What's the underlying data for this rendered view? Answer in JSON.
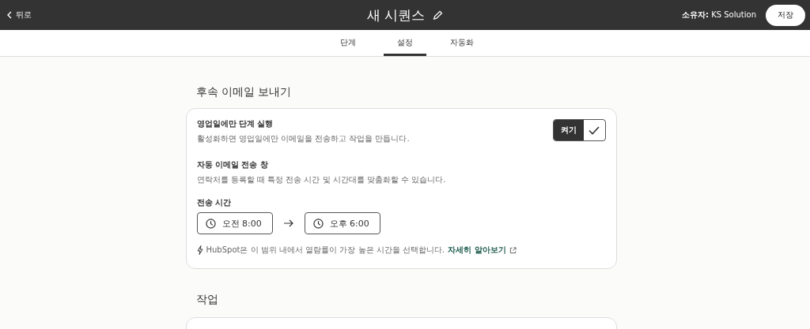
{
  "header": {
    "back": "뒤로",
    "title": "새 시퀀스",
    "owner_label": "소유자:",
    "owner": "KS Solution",
    "save": "저장"
  },
  "tabs": [
    {
      "label": "단계",
      "selected": false
    },
    {
      "label": "설정",
      "selected": true
    },
    {
      "label": "자동화",
      "selected": false
    }
  ],
  "section": {
    "title": "후속 이메일 보내기",
    "business_days": {
      "title": "영업일에만 단계 실행",
      "description": "활성화하면 영업일에만 이메일을 전송하고 작업을 만듭니다.",
      "toggle_label": "켜기",
      "on": true
    },
    "send_window": {
      "title": "자동 이메일 전송 창",
      "description": "연락처를 등록할 때 특정 전송 시간 및 시간대를 맞춤화할 수 있습니다.",
      "time_label": "전송 시간",
      "start": "오전 8:00",
      "end": "오후 6:00",
      "hint": "HubSpot은 이 범위 내에서 열람률이 가장 높은 시간을 선택합니다.",
      "link": "자세히 알아보기"
    }
  },
  "tasks": {
    "title": "작업"
  }
}
